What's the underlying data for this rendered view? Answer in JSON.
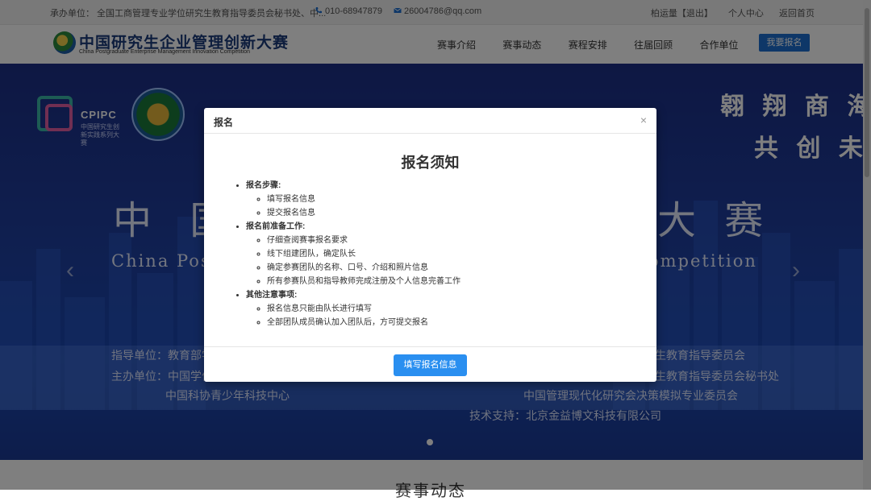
{
  "topbar": {
    "organizer": "承办单位：  全国工商管理专业学位研究生教育指导委员会秘书处、中...",
    "phone": "010-68947879",
    "email": "26004786@qq.com",
    "user_name": "柏运量",
    "logout": "【退出】",
    "personal_center": "个人中心",
    "back_home": "返回首页"
  },
  "nav": {
    "logo_title": "中国研究生企业管理创新大赛",
    "logo_subtitle": "China Postgraduate Enterprise Management Innovation Competition",
    "items": [
      {
        "label": "赛事介绍"
      },
      {
        "label": "赛事动态"
      },
      {
        "label": "赛程安排"
      },
      {
        "label": "往届回顾"
      },
      {
        "label": "合作单位"
      }
    ],
    "signup_button": "我要报名"
  },
  "banner": {
    "cpipc_label": "CPIPC",
    "cpipc_sub": "中国研究生创新实践系列大赛",
    "title_left": "中 国",
    "title_right": "大 赛",
    "en_left": "China Pos",
    "en_right": "ompetition",
    "calligraphy_line1": "翱 翔 商 海",
    "calligraphy_line2": "共 创 未 来",
    "guide_left": "指导单位：教育部学",
    "guide_right": "生教育指导委员会",
    "host_left": "主办单位：中国学位",
    "host_right": "生教育指导委员会秘书处",
    "co_left": "中国科协青少年科技中心",
    "co_right": "中国管理现代化研究会决策模拟专业委员会",
    "tech_support": "技术支持：北京金益博文科技有限公司"
  },
  "below": {
    "heading": "赛事动态"
  },
  "modal": {
    "header": "报名",
    "close": "×",
    "title": "报名须知",
    "sections": [
      {
        "label": "报名步骤:",
        "items": [
          "填写报名信息",
          "提交报名信息"
        ]
      },
      {
        "label": "报名前准备工作:",
        "items": [
          "仔细查阅赛事报名要求",
          "线下组建团队，确定队长",
          "确定参赛团队的名称、口号、介绍和照片信息",
          "所有参赛队员和指导教师完成注册及个人信息完善工作"
        ]
      },
      {
        "label": "其他注意事项:",
        "items": [
          "报名信息只能由队长进行填写",
          "全部团队成员确认加入团队后，方可提交报名"
        ]
      }
    ],
    "fill_button": "填写报名信息"
  },
  "colors": {
    "primary_blue": "#1d6fd0",
    "modal_button_blue": "#2a8ff0",
    "banner_blue": "#1f3fa0"
  }
}
